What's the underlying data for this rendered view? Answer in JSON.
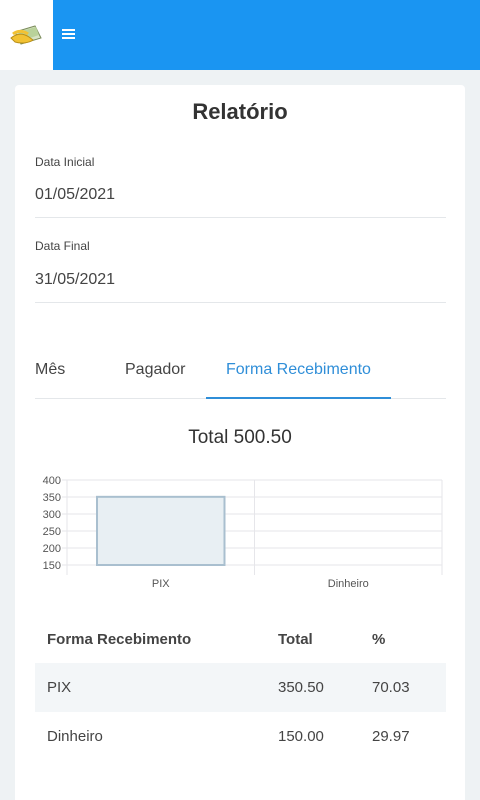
{
  "app": {
    "logo_icon": "money-hand-icon",
    "menu_icon": "hamburger-menu-icon",
    "brand_color": "#1a95f2"
  },
  "report": {
    "title": "Relatório",
    "start_date": {
      "label": "Data Inicial",
      "value": "01/05/2021"
    },
    "end_date": {
      "label": "Data Final",
      "value": "31/05/2021"
    },
    "tabs": [
      {
        "label": "Mês",
        "active": false
      },
      {
        "label": "Pagador",
        "active": false
      },
      {
        "label": "Forma Recebimento",
        "active": true
      }
    ],
    "total_text": "Total 500.50"
  },
  "chart_data": {
    "type": "bar",
    "categories": [
      "PIX",
      "Dinheiro"
    ],
    "values": [
      350.5,
      150.0
    ],
    "ylim": [
      150,
      400
    ],
    "yticks": [
      150,
      200,
      250,
      300,
      350,
      400
    ],
    "grid": true,
    "bar_fill": "#e8eff3",
    "bar_stroke": "#a9bfcf"
  },
  "table": {
    "headers": [
      "Forma Recebimento",
      "Total",
      "%"
    ],
    "rows": [
      [
        "PIX",
        "350.50",
        "70.03"
      ],
      [
        "Dinheiro",
        "150.00",
        "29.97"
      ]
    ]
  }
}
